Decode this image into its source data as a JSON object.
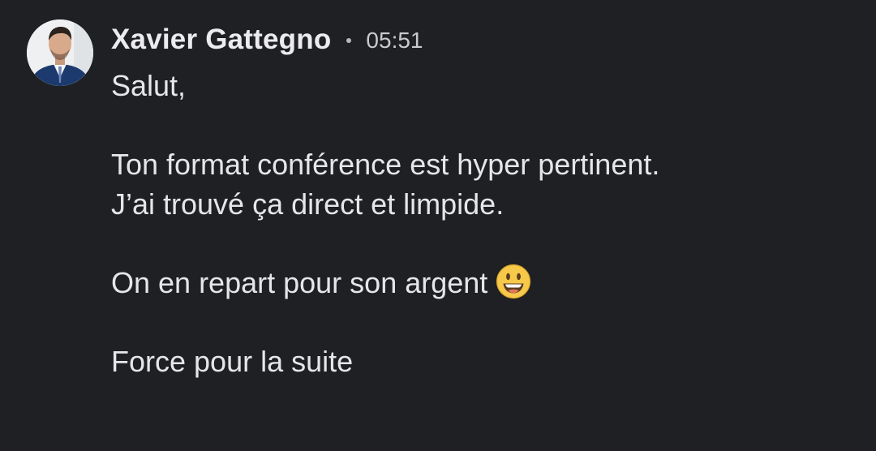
{
  "message": {
    "sender_name": "Xavier Gattegno",
    "timestamp": "05:51",
    "avatar_icon": "profile-photo",
    "lines": [
      "Salut,",
      "",
      "Ton format conférence est hyper pertinent.",
      "J’ai trouvé ça direct et limpide.",
      "",
      "On en repart pour son argent",
      "",
      "Force pour la suite"
    ],
    "emoji": "grinning-face-emoji"
  },
  "colors": {
    "background": "#1f2024",
    "text": "#e6e6e8",
    "timestamp": "#c9cacd"
  }
}
